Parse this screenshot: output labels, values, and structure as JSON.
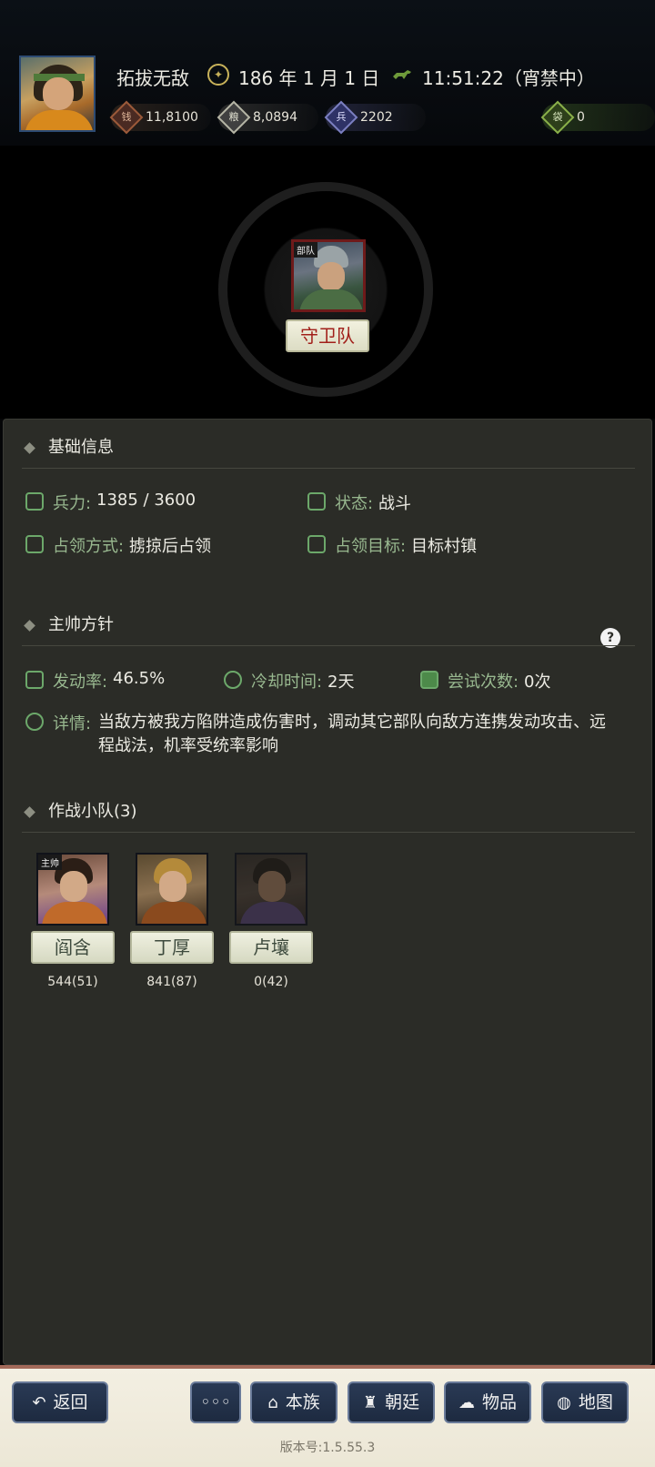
{
  "header": {
    "player_name": "拓拔无敌",
    "date": "186 年 1 月 1 日",
    "time": "11:51:22（宵禁中）",
    "resources": [
      {
        "icon": "coin-icon",
        "value": "11,8100"
      },
      {
        "icon": "grain-icon",
        "value": "8,0894"
      },
      {
        "icon": "soldier-icon",
        "value": "2202"
      },
      {
        "icon": "bag-icon",
        "value": "0"
      }
    ]
  },
  "troop": {
    "tag": "部队",
    "name": "守卫队"
  },
  "basic": {
    "title": "基础信息",
    "strength_label": "兵力:",
    "strength_value": "1385 / 3600",
    "status_label": "状态:",
    "status_value": "战斗",
    "occupy_mode_label": "占领方式:",
    "occupy_mode_value": "掳掠后占领",
    "occupy_target_label": "占领目标:",
    "occupy_target_value": "目标村镇"
  },
  "strategy": {
    "title": "主帅方针",
    "help": "?",
    "rate_label": "发动率:",
    "rate_value": "46.5%",
    "cooldown_label": "冷却时间:",
    "cooldown_value": "2天",
    "attempts_label": "尝试次数:",
    "attempts_value": "0次",
    "detail_label": "详情:",
    "detail_value": "当敌方被我方陷阱造成伤害时，调动其它部队向敌方连携发动攻击、远程战法，机率受统率影响"
  },
  "squad": {
    "title": "作战小队(3)",
    "members": [
      {
        "tag": "主帅",
        "name": "阎含",
        "stat": "544(51)"
      },
      {
        "tag": "",
        "name": "丁厚",
        "stat": "841(87)"
      },
      {
        "tag": "",
        "name": "卢壤",
        "stat": "0(42)"
      }
    ]
  },
  "nav": {
    "back": "返回",
    "more": "◦◦◦",
    "clan": "本族",
    "court": "朝廷",
    "items": "物品",
    "map": "地图"
  },
  "version": "版本号:1.5.55.3"
}
